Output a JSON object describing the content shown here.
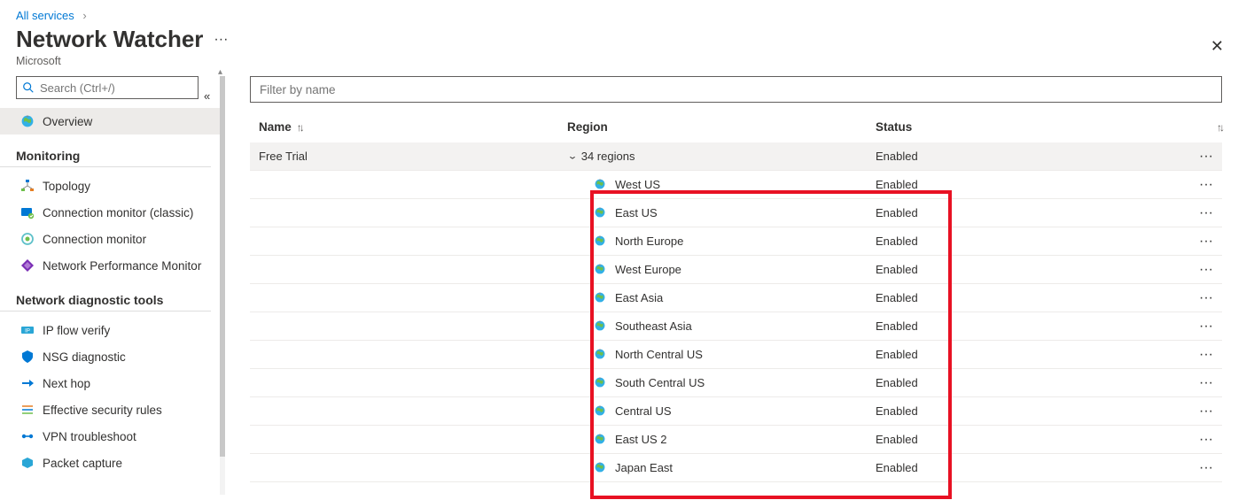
{
  "breadcrumb": {
    "all_services": "All services"
  },
  "page": {
    "title": "Network Watcher",
    "publisher": "Microsoft"
  },
  "search": {
    "placeholder": "Search (Ctrl+/)"
  },
  "sidebar": {
    "overview": "Overview",
    "section_monitoring": "Monitoring",
    "section_diag": "Network diagnostic tools",
    "items_monitoring": [
      {
        "label": "Topology"
      },
      {
        "label": "Connection monitor (classic)"
      },
      {
        "label": "Connection monitor"
      },
      {
        "label": "Network Performance Monitor"
      }
    ],
    "items_diag": [
      {
        "label": "IP flow verify"
      },
      {
        "label": "NSG diagnostic"
      },
      {
        "label": "Next hop"
      },
      {
        "label": "Effective security rules"
      },
      {
        "label": "VPN troubleshoot"
      },
      {
        "label": "Packet capture"
      }
    ]
  },
  "filter": {
    "placeholder": "Filter by name"
  },
  "table": {
    "headers": {
      "name": "Name",
      "region": "Region",
      "status": "Status"
    },
    "group_row": {
      "name": "Free Trial",
      "region_summary": "34 regions",
      "status": "Enabled"
    },
    "rows": [
      {
        "region": "West US",
        "status": "Enabled"
      },
      {
        "region": "East US",
        "status": "Enabled"
      },
      {
        "region": "North Europe",
        "status": "Enabled"
      },
      {
        "region": "West Europe",
        "status": "Enabled"
      },
      {
        "region": "East Asia",
        "status": "Enabled"
      },
      {
        "region": "Southeast Asia",
        "status": "Enabled"
      },
      {
        "region": "North Central US",
        "status": "Enabled"
      },
      {
        "region": "South Central US",
        "status": "Enabled"
      },
      {
        "region": "Central US",
        "status": "Enabled"
      },
      {
        "region": "East US 2",
        "status": "Enabled"
      },
      {
        "region": "Japan East",
        "status": "Enabled"
      }
    ]
  }
}
